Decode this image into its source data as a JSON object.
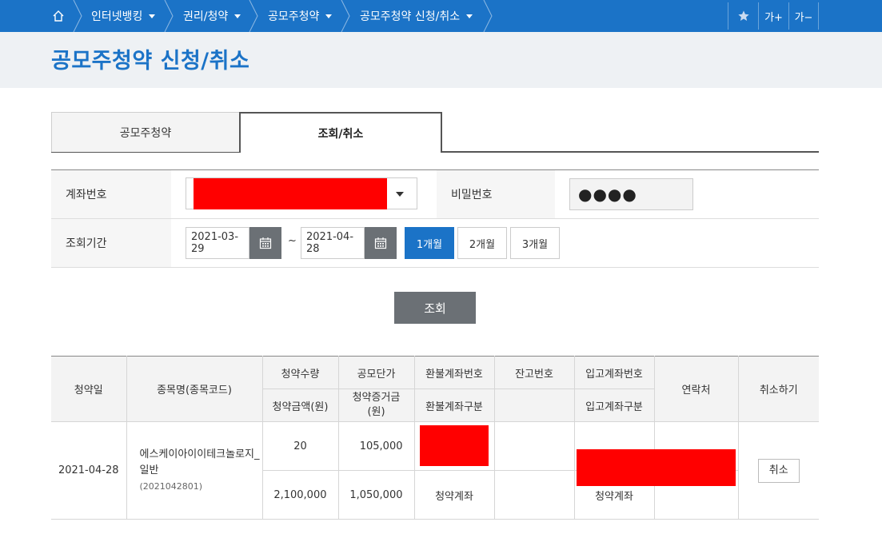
{
  "breadcrumb": {
    "home_icon": "home-icon",
    "items": [
      {
        "label": "인터넷뱅킹"
      },
      {
        "label": "권리/청약"
      },
      {
        "label": "공모주청약"
      },
      {
        "label": "공모주청약 신청/취소"
      }
    ],
    "tools": {
      "favorite_icon": "star-icon",
      "font_up": "가+",
      "font_down": "가−"
    }
  },
  "page_title": "공모주청약 신청/취소",
  "tabs": [
    {
      "label": "공모주청약",
      "active": false
    },
    {
      "label": "조회/취소",
      "active": true
    }
  ],
  "form": {
    "account_label": "계좌번호",
    "password_label": "비밀번호",
    "password_mask": "●●●●",
    "period_label": "조회기간",
    "start_date": "2021-03-29",
    "end_date": "2021-04-28",
    "tilde": "~",
    "period_buttons": [
      {
        "label": "1개월",
        "active": true
      },
      {
        "label": "2개월",
        "active": false
      },
      {
        "label": "3개월",
        "active": false
      }
    ],
    "search_button": "조회"
  },
  "table": {
    "headers": {
      "subscribe_date": "청약일",
      "stock_name": "종목명(종목코드)",
      "quantity": "청약수량",
      "amount": "청약금액(원)",
      "unit_price": "공모단가",
      "deposit": "청약증거금(원)",
      "refund_account": "환불계좌번호",
      "refund_type": "환불계좌구분",
      "balance_no": "잔고번호",
      "deposit_account": "입고계좌번호",
      "deposit_type": "입고계좌구분",
      "contact": "연락처",
      "cancel": "취소하기"
    },
    "rows": [
      {
        "date": "2021-04-28",
        "name": "에스케이아이이테크놀로지_일반",
        "code": "(2021042801)",
        "quantity": "20",
        "unit_price": "105,000",
        "amount": "2,100,000",
        "deposit": "1,050,000",
        "refund_type": "청약계좌",
        "deposit_type": "청약계좌",
        "cancel_label": "취소"
      }
    ]
  },
  "colors": {
    "accent": "#1b73c7",
    "button_gray": "#6b7075",
    "redaction": "#ff0000"
  }
}
